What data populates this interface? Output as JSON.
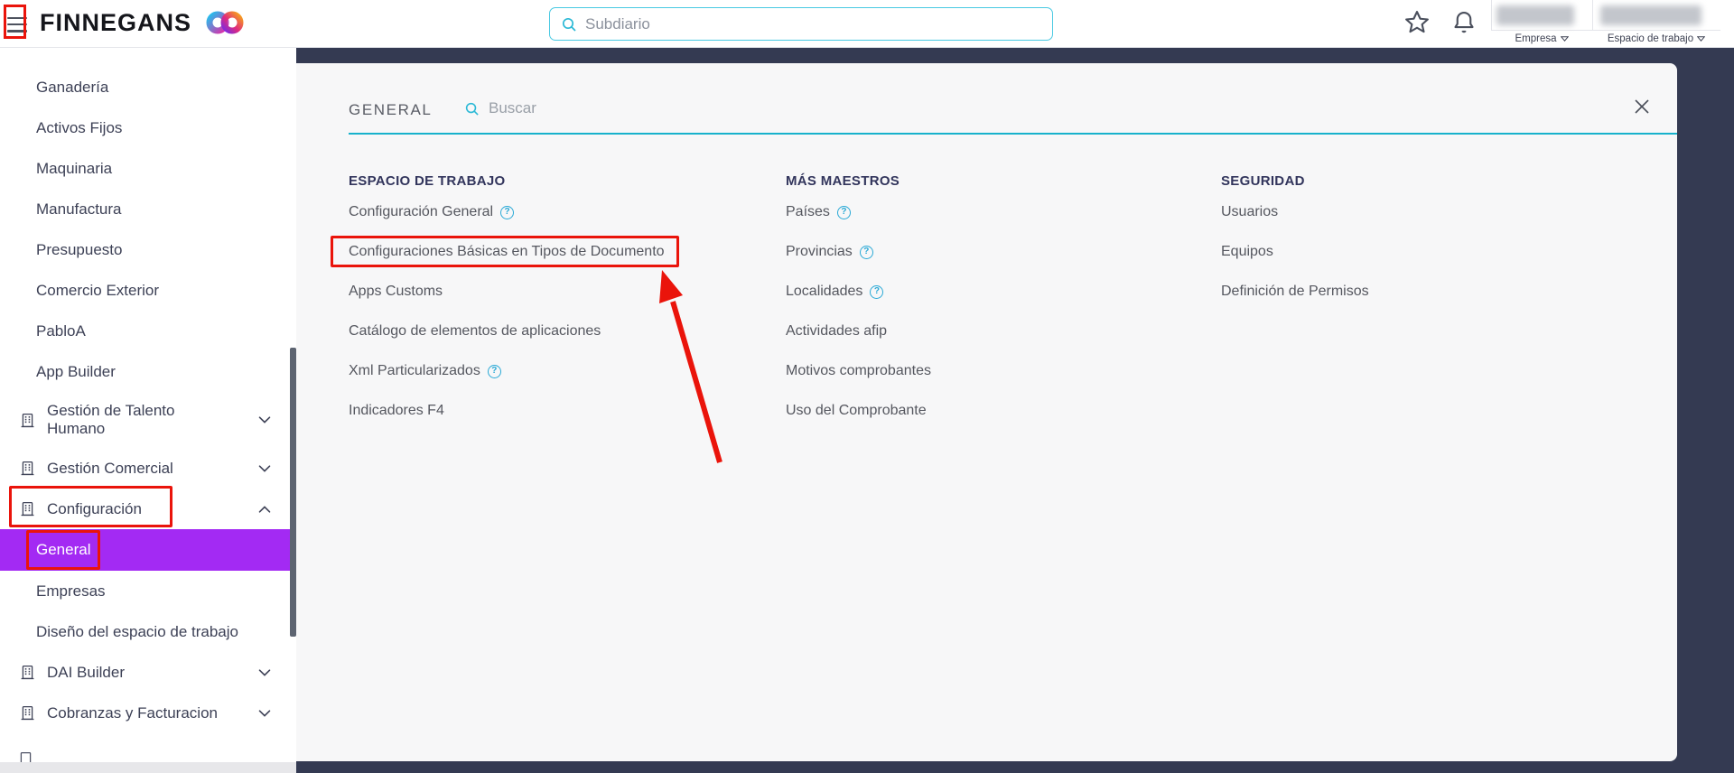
{
  "header": {
    "brand": "FINNEGANS",
    "search_placeholder": "Subdiario",
    "account": {
      "company_label": "Empresa",
      "workspace_label": "Espacio de trabajo"
    }
  },
  "sidebar": {
    "items": [
      {
        "label": "Ganadería",
        "type": "plain"
      },
      {
        "label": "Activos Fijos",
        "type": "plain"
      },
      {
        "label": "Maquinaria",
        "type": "plain"
      },
      {
        "label": "Manufactura",
        "type": "plain"
      },
      {
        "label": "Presupuesto",
        "type": "plain"
      },
      {
        "label": "Comercio Exterior",
        "type": "plain"
      },
      {
        "label": "PabloA",
        "type": "plain"
      },
      {
        "label": "App Builder",
        "type": "plain"
      },
      {
        "label": "Gestión de Talento Humano",
        "type": "module",
        "chevron": "down",
        "twoline": true
      },
      {
        "label": "Gestión Comercial",
        "type": "module",
        "chevron": "down"
      },
      {
        "label": "Configuración",
        "type": "module",
        "chevron": "up",
        "annotated": true
      },
      {
        "label": "General",
        "type": "sub",
        "active": true,
        "annotated": true
      },
      {
        "label": "Empresas",
        "type": "sub"
      },
      {
        "label": "Diseño del espacio de trabajo",
        "type": "sub"
      },
      {
        "label": "DAI Builder",
        "type": "module",
        "chevron": "down"
      },
      {
        "label": "Cobranzas y Facturacion",
        "type": "module",
        "chevron": "down"
      }
    ]
  },
  "overlay": {
    "title": "GENERAL",
    "search_placeholder": "Buscar",
    "columns": [
      {
        "title": "ESPACIO DE TRABAJO",
        "items": [
          {
            "label": "Configuración General",
            "info": true
          },
          {
            "label": "Configuraciones Básicas en Tipos de Documento",
            "annotated": true
          },
          {
            "label": "Apps Customs"
          },
          {
            "label": "Catálogo de elementos de aplicaciones"
          },
          {
            "label": "Xml Particularizados",
            "info": true
          },
          {
            "label": "Indicadores F4"
          }
        ]
      },
      {
        "title": "MÁS MAESTROS",
        "items": [
          {
            "label": "Países",
            "info": true
          },
          {
            "label": "Provincias",
            "info": true
          },
          {
            "label": "Localidades",
            "info": true
          },
          {
            "label": "Actividades afip"
          },
          {
            "label": "Motivos comprobantes"
          },
          {
            "label": "Uso del Comprobante"
          }
        ]
      },
      {
        "title": "SEGURIDAD",
        "items": [
          {
            "label": "Usuarios"
          },
          {
            "label": "Equipos"
          },
          {
            "label": "Definición de Permisos"
          }
        ]
      }
    ]
  },
  "colors": {
    "accent_purple": "#a32af3",
    "accent_cyan": "#2cb9d6",
    "annotation_red": "#ea140b",
    "backdrop_navy": "#343a52"
  },
  "annotations": {
    "color": "#ea140b",
    "highlighted_elements": [
      "menu-toggle",
      "Configuración",
      "General",
      "Configuraciones Básicas en Tipos de Documento"
    ]
  }
}
